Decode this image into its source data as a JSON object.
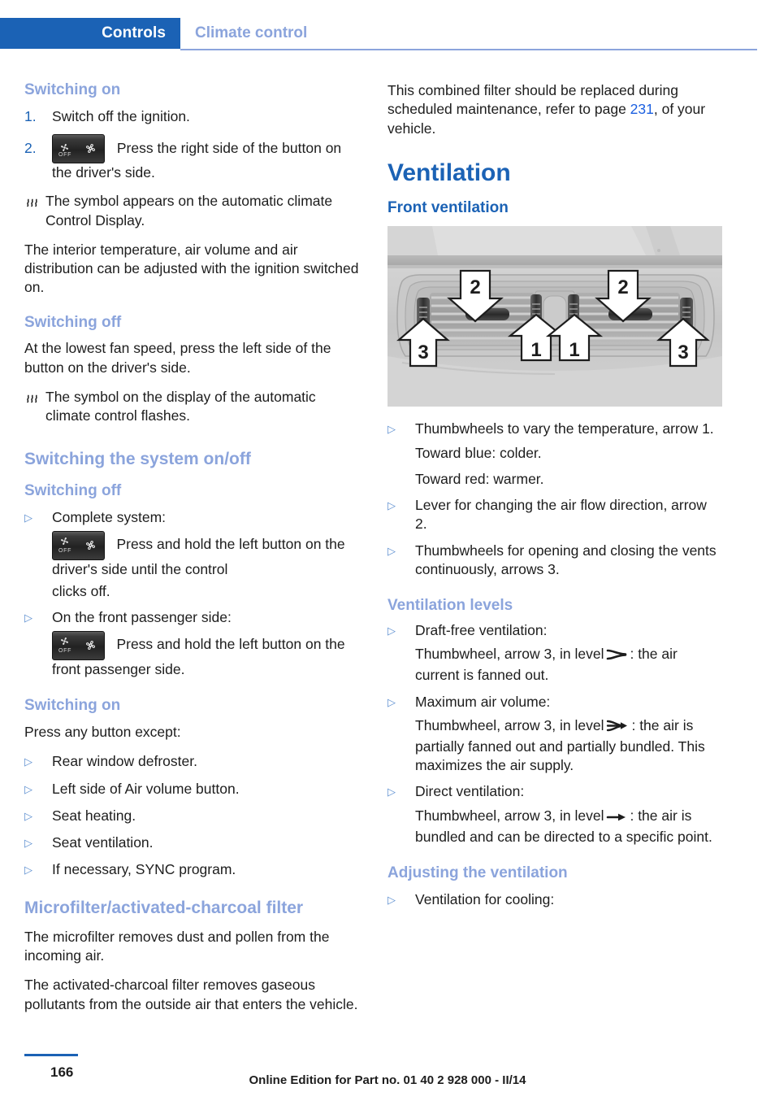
{
  "header": {
    "active_tab": "Controls",
    "breadcrumb": "Climate control"
  },
  "left_column": {
    "switching_on_heading": "Switching on",
    "step1_num": "1.",
    "step1_text": "Switch off the ignition.",
    "step2_num": "2.",
    "step2_text": "Press the right side of the button on the driver's side.",
    "steam_note_1": "The symbol appears on the automatic climate Control Display.",
    "para_1": "The interior temperature, air volume and air distribution can be adjusted with the ignition switched on.",
    "switching_off_heading": "Switching off",
    "para_2": "At the lowest fan speed, press the left side of the button on the driver's side.",
    "steam_note_2": "The symbol on the display of the automatic climate control flashes.",
    "system_onoff_heading": "Switching the system on/off",
    "system_off_heading": "Switching off",
    "bullet_complete_system": "Complete system:",
    "btn_text_1": "Press and hold the left button on the driver's side until the control",
    "btn_text_1_tail": "clicks off.",
    "bullet_passenger_side": "On the front passenger side:",
    "btn_text_2": "Press and hold the left button on the front passenger side.",
    "system_on_heading": "Switching on",
    "press_any_button": "Press any button except:",
    "exceptions": [
      "Rear window defroster.",
      "Left side of Air volume button.",
      "Seat heating.",
      "Seat ventilation.",
      "If necessary, SYNC program."
    ],
    "microfilter_heading": "Microfilter/activated-charcoal filter",
    "microfilter_para_1": "The microfilter removes dust and pollen from the incoming air.",
    "microfilter_para_2": "The activated-charcoal filter removes gaseous pollutants from the outside air that enters the vehicle."
  },
  "right_column": {
    "filter_para_pre": "This combined filter should be replaced during scheduled maintenance, refer to page ",
    "filter_page_link": "231",
    "filter_para_post": ", of your vehicle.",
    "ventilation_heading": "Ventilation",
    "front_ventilation_heading": "Front ventilation",
    "figure_labels": [
      "2",
      "2",
      "1",
      "1",
      "3",
      "3"
    ],
    "bullet_thumbwheels_temp": "Thumbwheels to vary the temperature, arrow 1.",
    "toward_blue": "Toward blue: colder.",
    "toward_red": "Toward red: warmer.",
    "bullet_lever": "Lever for changing the air flow direction, arrow 2.",
    "bullet_thumbwheels_open": "Thumbwheels for opening and closing the vents continuously, arrows 3.",
    "ventilation_levels_heading": "Ventilation levels",
    "level_draft_free": "Draft-free ventilation:",
    "level_draft_free_pre": "Thumbwheel, arrow 3, in level",
    "level_draft_free_post": ": the air current is fanned out.",
    "level_max_volume": "Maximum air volume:",
    "level_max_volume_pre": "Thumbwheel, arrow 3, in level",
    "level_max_volume_post": ": the air is partially fanned out and partially bundled. This maximizes the air supply.",
    "level_direct": "Direct ventilation:",
    "level_direct_pre": "Thumbwheel, arrow 3, in level",
    "level_direct_post": ": the air is bundled and can be directed to a specific point.",
    "adjusting_heading": "Adjusting the ventilation",
    "bullet_cooling": "Ventilation for cooling:"
  },
  "footer": {
    "page_number": "166",
    "note": "Online Edition for Part no. 01 40 2 928 000 - II/14"
  },
  "icons": {
    "bullet": "▷",
    "steam": "steam-symbol",
    "fan": "fan-symbol",
    "level_fanned": "airflow-fanned-icon",
    "level_mixed": "airflow-mixed-icon",
    "level_direct": "airflow-direct-arrow-icon"
  },
  "colors": {
    "accent_blue": "#1b62b5",
    "light_blue": "#8ba4dc",
    "link_blue": "#1b5fe0",
    "text": "#1d1d1d"
  }
}
